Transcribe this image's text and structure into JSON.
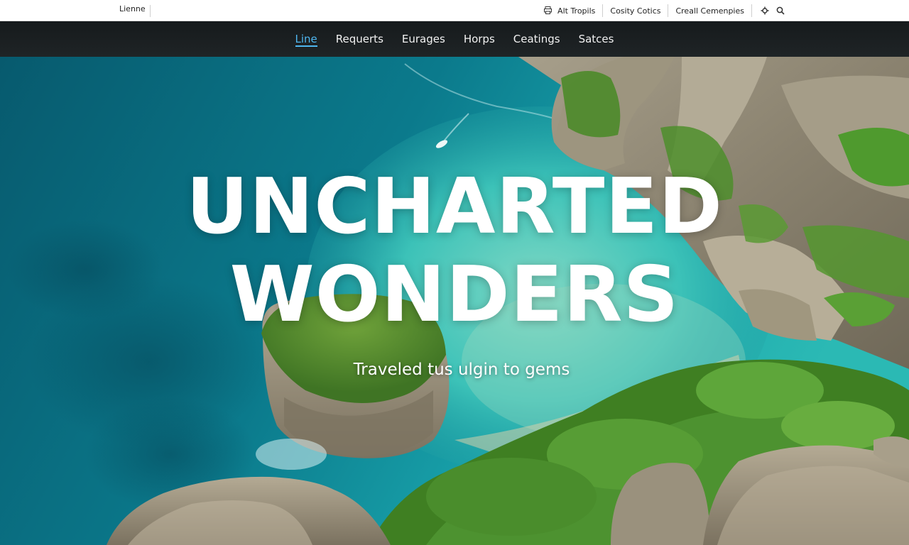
{
  "utility_bar": {
    "brand": "Lienne",
    "links": [
      {
        "label": "Alt Tropils",
        "icon": "print-icon"
      },
      {
        "label": "Cosity Cotics",
        "icon": ""
      },
      {
        "label": "Creall Cemenpies",
        "icon": ""
      }
    ],
    "icons": [
      "settings-icon",
      "search-icon"
    ]
  },
  "nav": {
    "items": [
      {
        "label": "Line",
        "active": true
      },
      {
        "label": "Requerts",
        "active": false
      },
      {
        "label": "Eurages",
        "active": false
      },
      {
        "label": "Horps",
        "active": false
      },
      {
        "label": "Ceatings",
        "active": false
      },
      {
        "label": "Satces",
        "active": false
      }
    ],
    "active_color": "#4fb6ef"
  },
  "hero": {
    "title_line1": "UNCHARTED",
    "title_line2": "WONDERS",
    "subtitle": "Traveled tus ulgin to gems",
    "colors": {
      "sea_deep": "#06556a",
      "sea_mid": "#0e8596",
      "lagoon": "#35c4be",
      "sand": "#c9c3a3",
      "rock": "#8e8677",
      "greenery": "#4a8a2c"
    }
  }
}
